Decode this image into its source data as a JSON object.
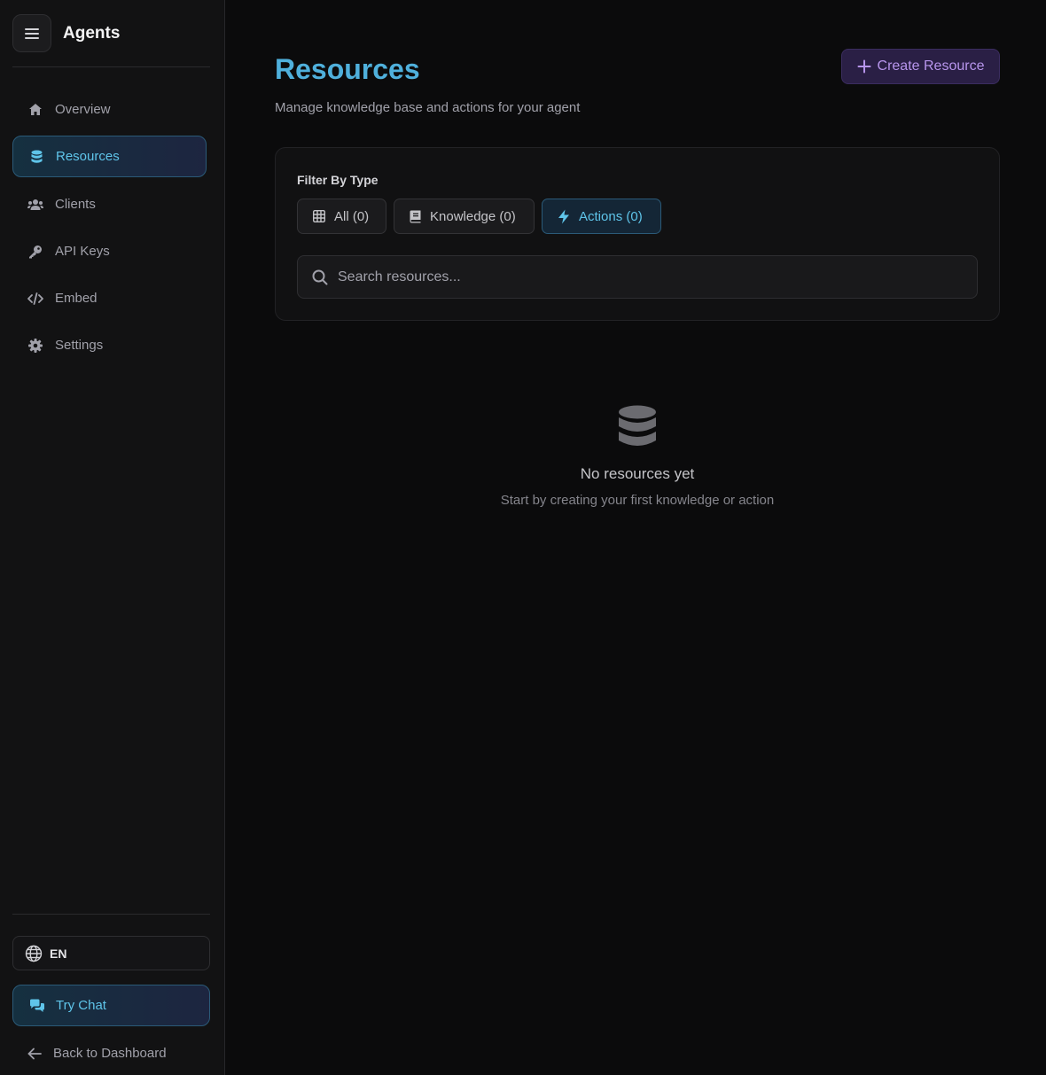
{
  "sidebar": {
    "app_title": "Agents",
    "items": [
      {
        "label": "Overview",
        "icon": "home-icon"
      },
      {
        "label": "Resources",
        "icon": "database-icon",
        "active": true
      },
      {
        "label": "Clients",
        "icon": "users-icon"
      },
      {
        "label": "API Keys",
        "icon": "key-icon"
      },
      {
        "label": "Embed",
        "icon": "code-icon"
      },
      {
        "label": "Settings",
        "icon": "gear-icon"
      }
    ],
    "language": "EN",
    "try_chat": "Try Chat",
    "back": "Back to Dashboard"
  },
  "main": {
    "title": "Resources",
    "subtitle": "Manage knowledge base and actions for your agent",
    "create_button": "Create Resource",
    "filter": {
      "label": "Filter By Type",
      "chips": [
        {
          "label": "All (0)",
          "icon": "grid-icon"
        },
        {
          "label": "Knowledge (0)",
          "icon": "book-icon"
        },
        {
          "label": "Actions (0)",
          "icon": "bolt-icon",
          "active": true
        }
      ],
      "search_placeholder": "Search resources...",
      "search_value": ""
    },
    "empty": {
      "title": "No resources yet",
      "subtitle": "Start by creating your first knowledge or action"
    }
  },
  "colors": {
    "accent": "#4fb0dc",
    "active_text": "#5fc5ea",
    "create_text": "#b795ec"
  }
}
